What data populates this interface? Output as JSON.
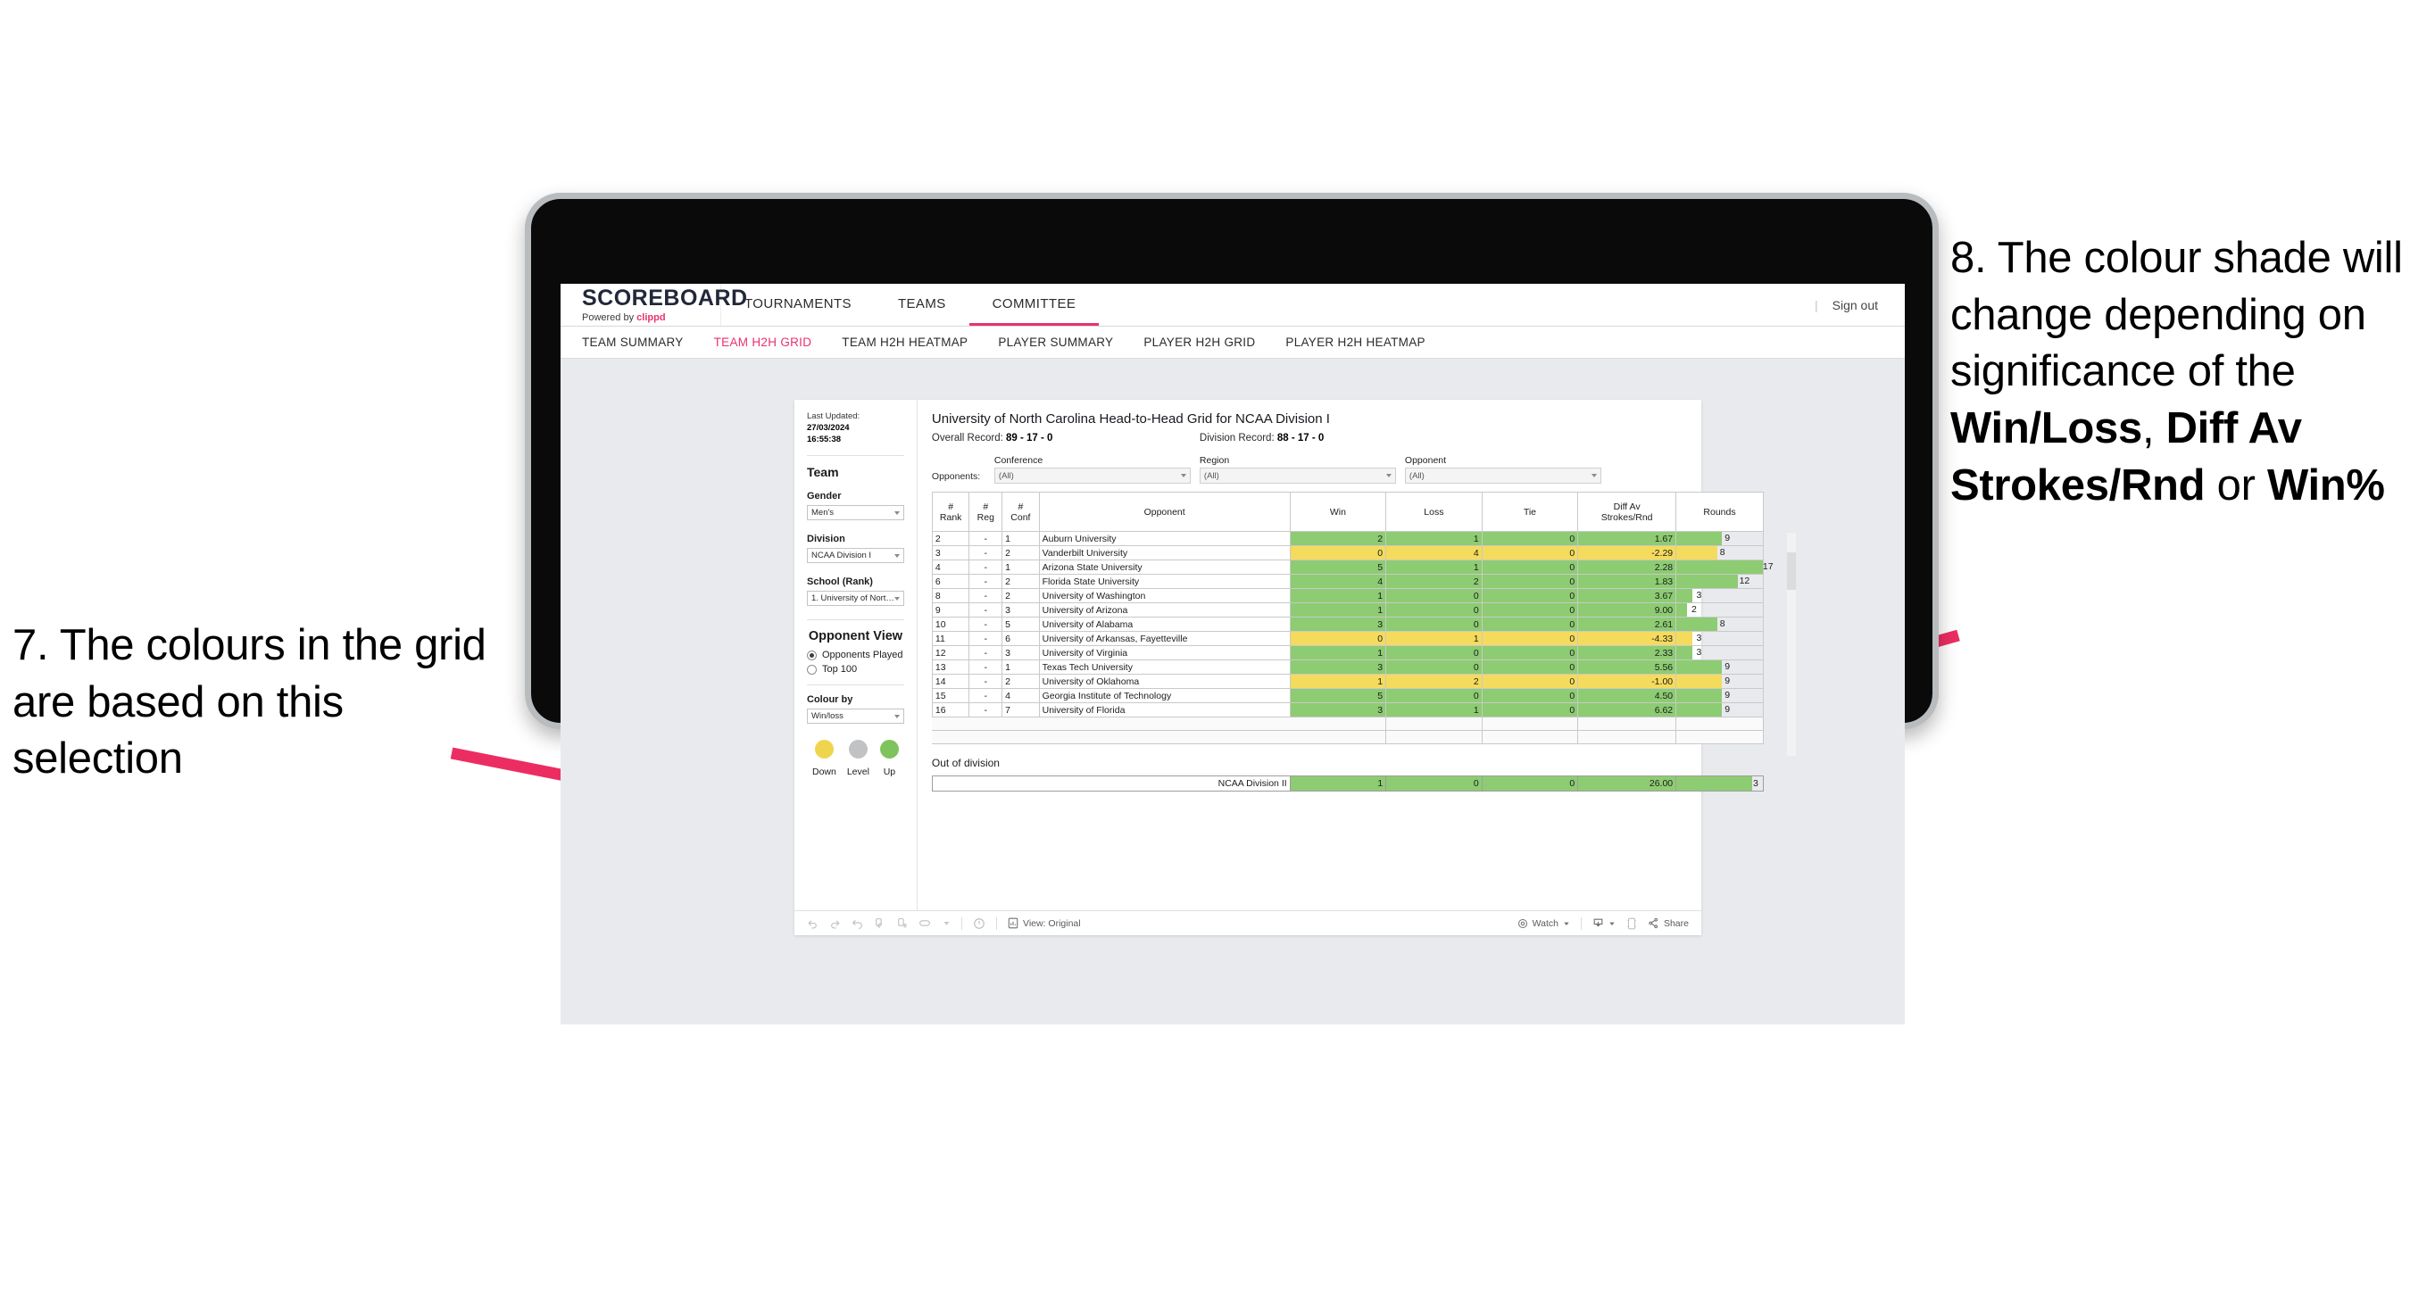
{
  "annotations": {
    "left": "7. The colours in the grid are based on this selection",
    "right_parts": [
      {
        "text": "8. The colour shade will change depending on significance of the ",
        "bold": false
      },
      {
        "text": "Win/Loss",
        "bold": true
      },
      {
        "text": ", ",
        "bold": false
      },
      {
        "text": "Diff Av Strokes/Rnd",
        "bold": true
      },
      {
        "text": " or ",
        "bold": false
      },
      {
        "text": "Win%",
        "bold": true
      }
    ],
    "arrow_color": "#EC2D62"
  },
  "app": {
    "brand": {
      "title": "SCOREBOARD",
      "powered_prefix": "Powered by ",
      "powered_name": "clippd"
    },
    "topnav": [
      {
        "label": "TOURNAMENTS",
        "active": false
      },
      {
        "label": "TEAMS",
        "active": false
      },
      {
        "label": "COMMITTEE",
        "active": true
      }
    ],
    "signout": {
      "separator": "|",
      "label": "Sign out"
    },
    "subnav": [
      {
        "label": "TEAM SUMMARY",
        "active": false
      },
      {
        "label": "TEAM H2H GRID",
        "active": true
      },
      {
        "label": "TEAM H2H HEATMAP",
        "active": false
      },
      {
        "label": "PLAYER SUMMARY",
        "active": false
      },
      {
        "label": "PLAYER H2H GRID",
        "active": false
      },
      {
        "label": "PLAYER H2H HEATMAP",
        "active": false
      }
    ]
  },
  "sidebar": {
    "last_updated_label": "Last Updated:",
    "last_updated_date": "27/03/2024",
    "last_updated_time": "16:55:38",
    "team_heading": "Team",
    "fields": [
      {
        "label": "Gender",
        "value": "Men's"
      },
      {
        "label": "Division",
        "value": "NCAA Division I"
      },
      {
        "label": "School (Rank)",
        "value": "1. University of Nort…"
      }
    ],
    "opponent_view": {
      "heading": "Opponent View",
      "options": [
        {
          "label": "Opponents Played",
          "selected": true
        },
        {
          "label": "Top 100",
          "selected": false
        }
      ]
    },
    "colour_by": {
      "label": "Colour by",
      "value": "Win/loss"
    },
    "legend": [
      {
        "label": "Down",
        "color": "#F0D44E"
      },
      {
        "label": "Level",
        "color": "#C0C2C4"
      },
      {
        "label": "Up",
        "color": "#7FC35D"
      }
    ]
  },
  "viz": {
    "title": "University of North Carolina Head-to-Head Grid for NCAA Division I",
    "overall_record_label": "Overall Record:",
    "overall_record_value": "89 - 17 - 0",
    "division_record_label": "Division Record:",
    "division_record_value": "88 - 17 - 0",
    "opponents_label": "Opponents:",
    "opponent_filters": [
      {
        "label": "Conference",
        "value": "(All)"
      },
      {
        "label": "Region",
        "value": "(All)"
      },
      {
        "label": "Opponent",
        "value": "(All)"
      }
    ],
    "out_of_division_label": "Out of division",
    "out_of_division_row": {
      "name": "NCAA Division II",
      "win": "1",
      "loss": "0",
      "tie": "0",
      "diff": "26.00",
      "rounds": "3",
      "color": "#8DCC72",
      "rounds_pct": 88
    }
  },
  "chart_data": {
    "type": "table",
    "title": "University of North Carolina Head-to-Head Grid for NCAA Division I",
    "columns": [
      "# Rank",
      "# Reg",
      "# Conf",
      "Opponent",
      "Win",
      "Loss",
      "Tie",
      "Diff Av Strokes/Rnd",
      "Rounds"
    ],
    "color_scale": {
      "up": "#8DCC72",
      "down": "#F5DB5C",
      "level": "#C0C2C4"
    },
    "rounds_max": 17,
    "rows": [
      {
        "rank": "2",
        "reg": "-",
        "conf": "1",
        "opponent": "Auburn University",
        "win": "2",
        "loss": "1",
        "tie": "0",
        "diff": "1.67",
        "rounds": "9",
        "color": "#8DCC72",
        "rounds_pct": 53
      },
      {
        "rank": "3",
        "reg": "-",
        "conf": "2",
        "opponent": "Vanderbilt University",
        "win": "0",
        "loss": "4",
        "tie": "0",
        "diff": "-2.29",
        "rounds": "8",
        "color": "#F5DB5C",
        "rounds_pct": 47
      },
      {
        "rank": "4",
        "reg": "-",
        "conf": "1",
        "opponent": "Arizona State University",
        "win": "5",
        "loss": "1",
        "tie": "0",
        "diff": "2.28",
        "rounds": "17",
        "color": "#8DCC72",
        "rounds_pct": 100
      },
      {
        "rank": "6",
        "reg": "-",
        "conf": "2",
        "opponent": "Florida State University",
        "win": "4",
        "loss": "2",
        "tie": "0",
        "diff": "1.83",
        "rounds": "12",
        "color": "#8DCC72",
        "rounds_pct": 71
      },
      {
        "rank": "8",
        "reg": "-",
        "conf": "2",
        "opponent": "University of Washington",
        "win": "1",
        "loss": "0",
        "tie": "0",
        "diff": "3.67",
        "rounds": "3",
        "color": "#8DCC72",
        "rounds_pct": 18
      },
      {
        "rank": "9",
        "reg": "-",
        "conf": "3",
        "opponent": "University of Arizona",
        "win": "1",
        "loss": "0",
        "tie": "0",
        "diff": "9.00",
        "rounds": "2",
        "color": "#8DCC72",
        "rounds_pct": 12
      },
      {
        "rank": "10",
        "reg": "-",
        "conf": "5",
        "opponent": "University of Alabama",
        "win": "3",
        "loss": "0",
        "tie": "0",
        "diff": "2.61",
        "rounds": "8",
        "color": "#8DCC72",
        "rounds_pct": 47
      },
      {
        "rank": "11",
        "reg": "-",
        "conf": "6",
        "opponent": "University of Arkansas, Fayetteville",
        "win": "0",
        "loss": "1",
        "tie": "0",
        "diff": "-4.33",
        "rounds": "3",
        "color": "#F5DB5C",
        "rounds_pct": 18
      },
      {
        "rank": "12",
        "reg": "-",
        "conf": "3",
        "opponent": "University of Virginia",
        "win": "1",
        "loss": "0",
        "tie": "0",
        "diff": "2.33",
        "rounds": "3",
        "color": "#8DCC72",
        "rounds_pct": 18
      },
      {
        "rank": "13",
        "reg": "-",
        "conf": "1",
        "opponent": "Texas Tech University",
        "win": "3",
        "loss": "0",
        "tie": "0",
        "diff": "5.56",
        "rounds": "9",
        "color": "#8DCC72",
        "rounds_pct": 53
      },
      {
        "rank": "14",
        "reg": "-",
        "conf": "2",
        "opponent": "University of Oklahoma",
        "win": "1",
        "loss": "2",
        "tie": "0",
        "diff": "-1.00",
        "rounds": "9",
        "color": "#F5DB5C",
        "rounds_pct": 53
      },
      {
        "rank": "15",
        "reg": "-",
        "conf": "4",
        "opponent": "Georgia Institute of Technology",
        "win": "5",
        "loss": "0",
        "tie": "0",
        "diff": "4.50",
        "rounds": "9",
        "color": "#8DCC72",
        "rounds_pct": 53
      },
      {
        "rank": "16",
        "reg": "-",
        "conf": "7",
        "opponent": "University of Florida",
        "win": "3",
        "loss": "1",
        "tie": "0",
        "diff": "6.62",
        "rounds": "9",
        "color": "#8DCC72",
        "rounds_pct": 53
      }
    ]
  },
  "vizbar": {
    "view_label": "View: Original",
    "watch_label": "Watch",
    "share_label": "Share"
  }
}
